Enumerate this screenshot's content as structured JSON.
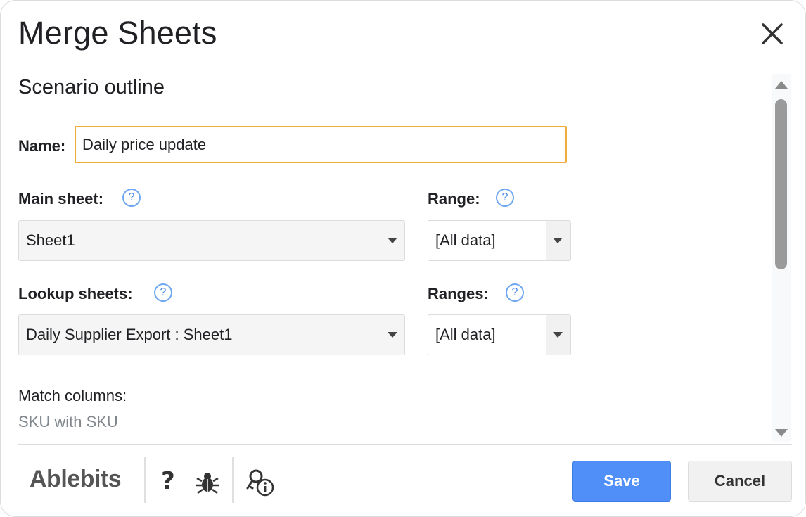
{
  "dialog": {
    "title": "Merge Sheets",
    "close_icon": "close-icon"
  },
  "outline": {
    "section_title": "Scenario outline",
    "name_label": "Name:",
    "name_value": "Daily price update",
    "main_sheet_label": "Main sheet:",
    "main_sheet_value": "Sheet1",
    "range_label": "Range:",
    "range_value": "[All data]",
    "lookup_sheets_label": "Lookup sheets:",
    "lookup_sheets_value": "Daily Supplier Export : Sheet1",
    "ranges_label": "Ranges:",
    "ranges_value": "[All data]",
    "help_glyph": "?",
    "match_columns_label": "Match columns:",
    "match_columns_value": "SKU with SKU"
  },
  "footer": {
    "logo": "Ablebits",
    "help_glyph": "?",
    "save_label": "Save",
    "cancel_label": "Cancel"
  },
  "colors": {
    "accent": "#4f8ff7",
    "input_focus": "#f0ad3a",
    "help_blue": "#6fa8f0"
  }
}
